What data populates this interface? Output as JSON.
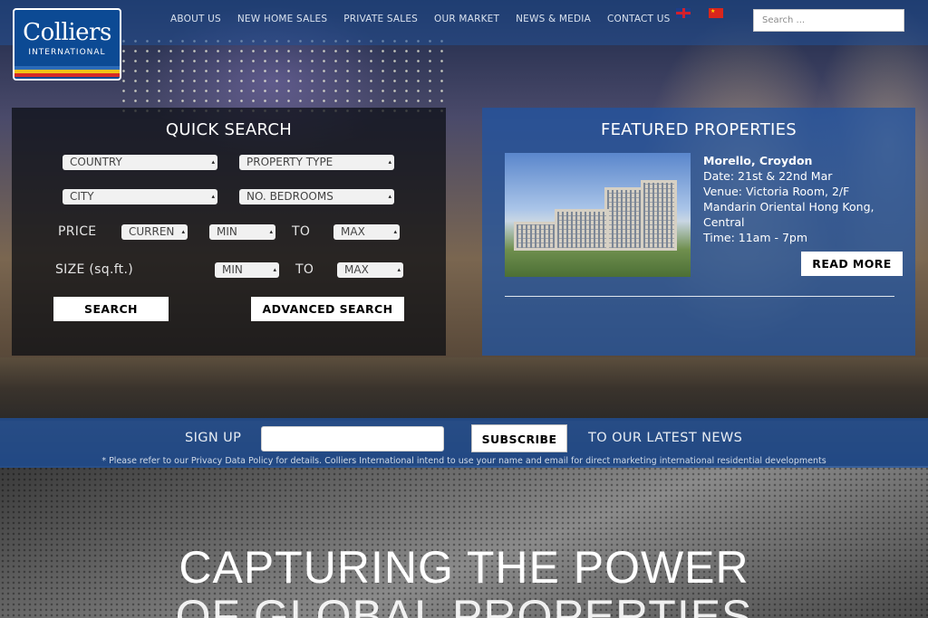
{
  "brand": {
    "name": "Colliers",
    "sub": "INTERNATIONAL",
    "stripes": [
      "#2b6ab7",
      "#f2c318",
      "#d62b26"
    ]
  },
  "nav": {
    "items": [
      "ABOUT US",
      "NEW HOME SALES",
      "PRIVATE SALES",
      "OUR MARKET",
      "NEWS & MEDIA",
      "CONTACT US"
    ]
  },
  "languages": {
    "english": "flag-uk-icon",
    "chinese": "flag-cn-icon"
  },
  "search": {
    "placeholder": "Search ..."
  },
  "quick_search": {
    "title": "QUICK SEARCH",
    "country": "COUNTRY",
    "property_type": "PROPERTY TYPE",
    "city": "CITY",
    "bedrooms": "NO. BEDROOMS",
    "price_label": "PRICE",
    "currency": "CURREN",
    "price_min": "MIN",
    "to_1": "TO",
    "price_max": "MAX",
    "size_label": "SIZE (sq.ft.)",
    "size_min": "MIN",
    "to_2": "TO",
    "size_max": "MAX",
    "search_button": "SEARCH",
    "advanced_button": "ADVANCED SEARCH"
  },
  "featured": {
    "title": "FEATURED PROPERTIES",
    "property_name": "Morello, Croydon",
    "date": "Date: 21st & 22nd Mar",
    "venue": "Venue: Victoria Room, 2/F Mandarin Oriental Hong Kong, Central",
    "time": "Time: 11am - 7pm",
    "read_more": "READ MORE"
  },
  "signup": {
    "label": "SIGN UP",
    "button": "SUBSCRIBE",
    "suffix": "TO OUR LATEST NEWS",
    "notice": "* Please refer to our Privacy Data Policy for details. Colliers International intend to use your name and email for direct marketing international residential developments"
  },
  "hero": {
    "line1": "CAPTURING THE POWER",
    "line2": "OF GLOBAL PROPERTIES"
  }
}
